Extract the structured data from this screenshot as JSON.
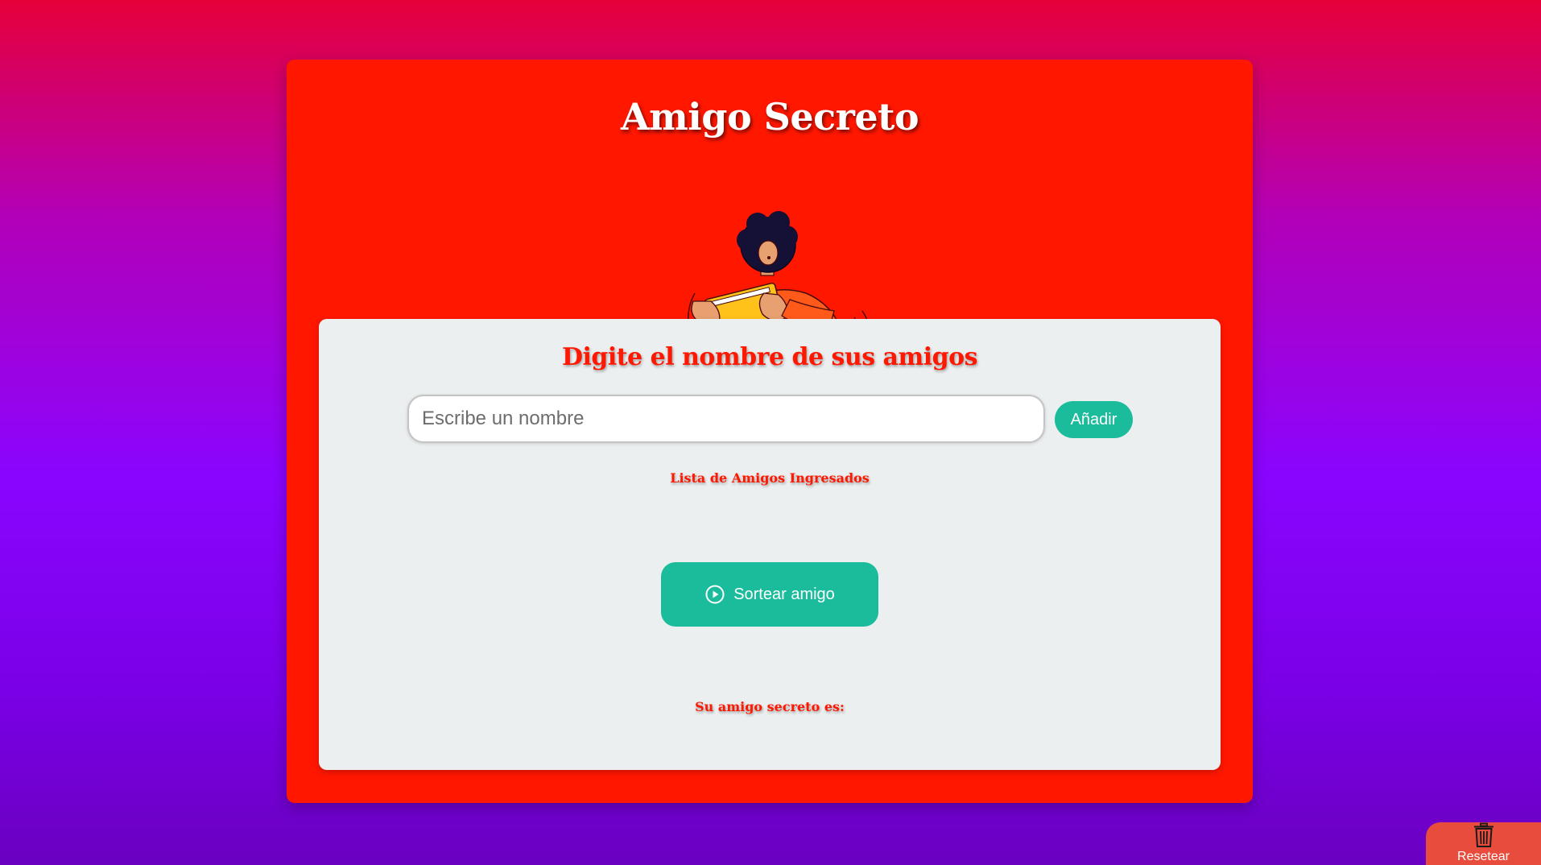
{
  "header": {
    "title": "Amigo Secreto"
  },
  "form": {
    "heading": "Digite el nombre de sus amigos",
    "input_placeholder": "Escribe un nombre",
    "input_value": "",
    "add_label": "Añadir"
  },
  "list": {
    "heading": "Lista de Amigos Ingresados",
    "items": []
  },
  "draw": {
    "label": "Sortear amigo",
    "icon": "play-circle-icon"
  },
  "result": {
    "heading": "Su amigo secreto es:"
  },
  "reset": {
    "label": "Resetear",
    "icon": "trash-icon"
  },
  "colors": {
    "card": "#ff1700",
    "panel": "#eceff0",
    "accent": "#1abc9c",
    "reset": "#e74c3c"
  }
}
